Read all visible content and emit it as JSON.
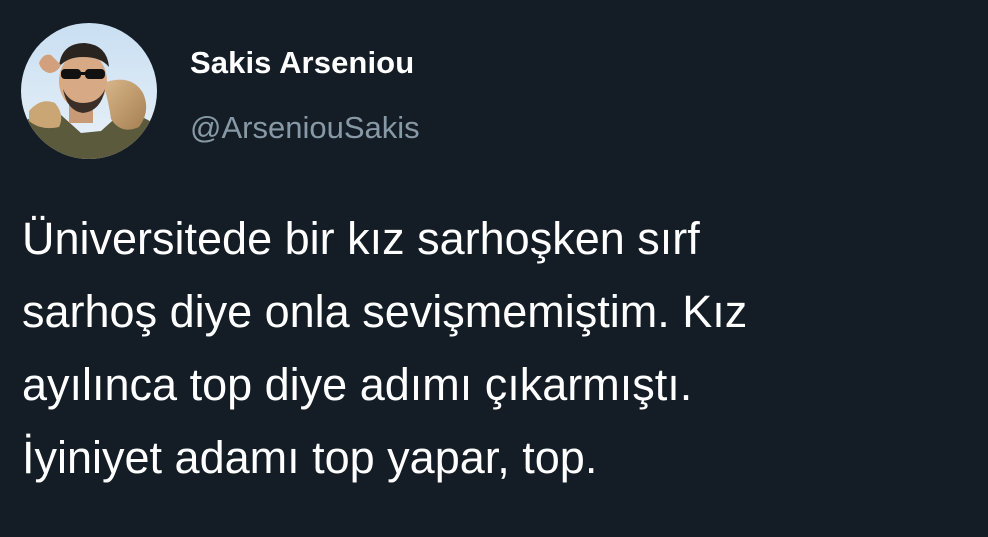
{
  "author": {
    "display_name": "Sakis Arseniou",
    "handle": "@ArseniouSakis"
  },
  "tweet": {
    "lines": [
      "Üniversitede bir kız sarhoşken sırf",
      "sarhoş diye onla sevişmemiştim. Kız",
      "ayılınca top diye adımı çıkarmıştı.",
      "İyiniyet adamı top yapar, top."
    ]
  },
  "colors": {
    "background": "#141d26",
    "name": "#ffffff",
    "handle": "#8899a6",
    "text": "#ffffff"
  }
}
